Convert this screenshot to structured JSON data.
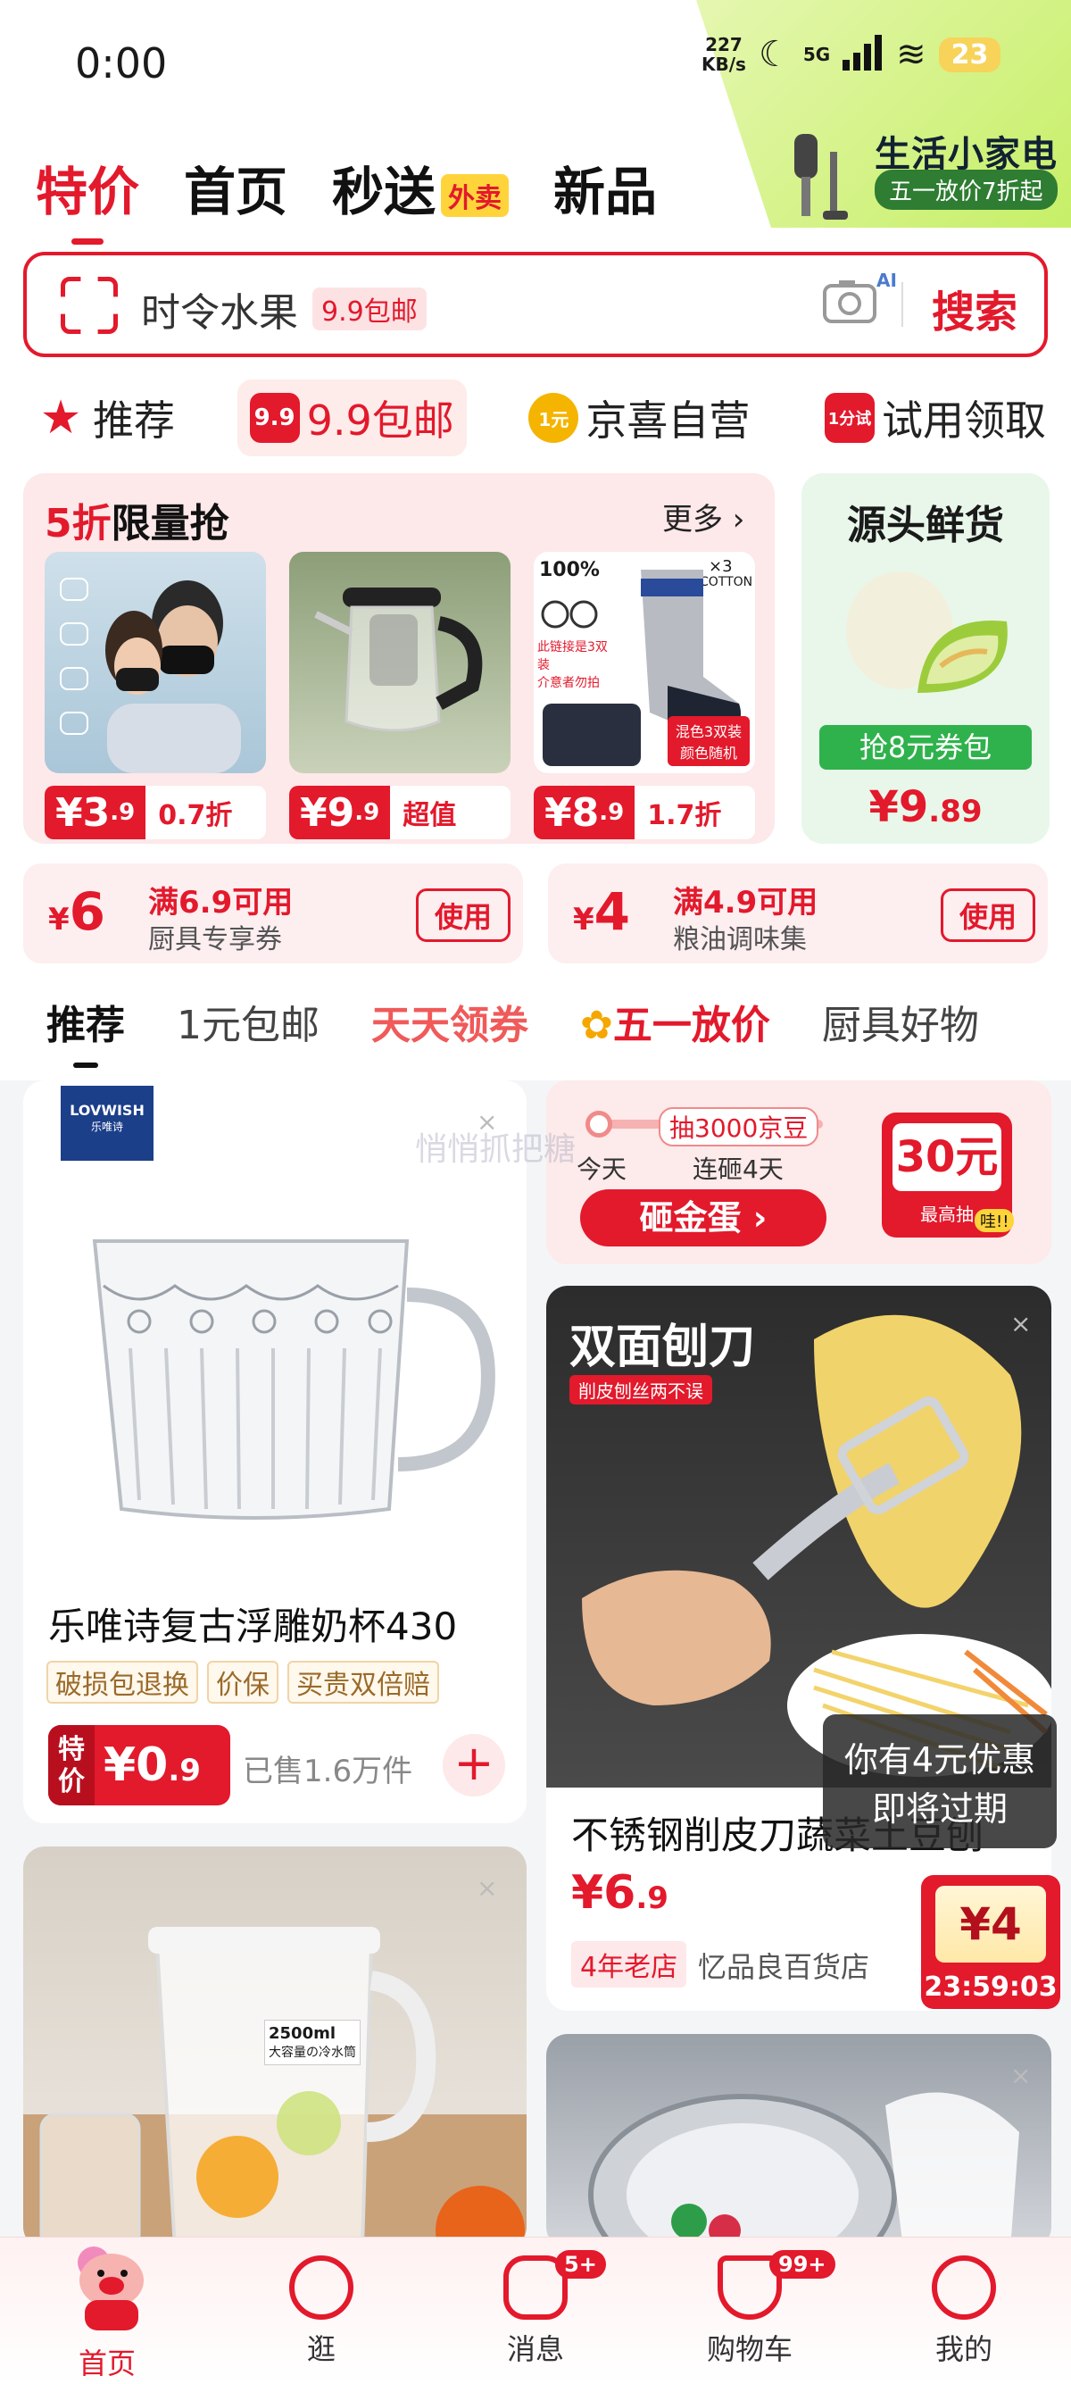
{
  "status": {
    "time": "0:00",
    "speed_top": "227",
    "speed_unit": "KB/s",
    "network": "5G",
    "battery": "23"
  },
  "promo": {
    "title": "生活小家电",
    "subtitle": "五一放价7折起"
  },
  "nav": {
    "tabs": [
      "特价",
      "首页",
      "秒送",
      "新品"
    ],
    "waimai": "外卖"
  },
  "search": {
    "text": "时令水果",
    "tag": "9.9包邮",
    "ai": "AI",
    "button": "搜索"
  },
  "cats": [
    {
      "label": "推荐",
      "icon": "★"
    },
    {
      "label": "9.9包邮",
      "icon": "9.9"
    },
    {
      "label": "京喜自营",
      "icon": "1元"
    },
    {
      "label": "试用领取",
      "icon": "1分试"
    }
  ],
  "flash": {
    "title_red": "5折",
    "title_rest": "限量抢",
    "more": "更多 ›",
    "items": [
      {
        "price": "¥3",
        "dec": ".9",
        "tag": "0.7折"
      },
      {
        "price": "¥9",
        "dec": ".9",
        "tag": "超值"
      },
      {
        "price": "¥8",
        "dec": ".9",
        "tag": "1.7折"
      }
    ],
    "socks_100": "100%",
    "socks_x3": "×3",
    "socks_cotton": "COTTON",
    "socks_note": "此链接是3双装\n介意者勿拍",
    "socks_badge": "混色3双装\n颜色随机"
  },
  "fresh": {
    "title": "源头鲜货",
    "btn": "抢8元券包",
    "price": "¥9",
    "dec": ".89"
  },
  "coupons": [
    {
      "amount": "6",
      "cond": "满6.9可用",
      "name": "厨具专享券",
      "btn": "使用"
    },
    {
      "amount": "4",
      "cond": "满4.9可用",
      "name": "粮油调味集",
      "btn": "使用"
    }
  ],
  "feed_tabs": [
    "推荐",
    "1元包邮",
    "天天领券",
    "五一放价",
    "厨具好物"
  ],
  "card1": {
    "brand": "LOVWISH",
    "brand_sub": "乐唯诗",
    "title": "乐唯诗复古浮雕奶杯430",
    "tags": [
      "破损包退换",
      "价保",
      "买贵双倍赔"
    ],
    "special": "特价",
    "price": "¥0",
    "dec": ".9",
    "sold": "已售1.6万件"
  },
  "egg": {
    "lottery": "抽3000京豆",
    "today": "今天",
    "streak": "连砸4天",
    "button": "砸金蛋 ›",
    "prize": "30元",
    "prize_label": "最高抽",
    "wow": "哇!!"
  },
  "card2": {
    "img_title": "双面刨刀",
    "img_sub": "削皮刨丝两不误",
    "title": "不锈钢削皮刀蔬菜土豆刨",
    "price": "¥6",
    "dec": ".9",
    "shop_tag": "4年老店",
    "shop": "忆品良百货店"
  },
  "jug": {
    "label1": "2500ml",
    "label2": "大容量の冷水筒"
  },
  "tooltip": "你有4元优惠\n即将过期",
  "timer": {
    "amount": "¥4",
    "time": "23:59:03"
  },
  "watermark": "悄悄抓把糖",
  "bottom": [
    {
      "label": "首页"
    },
    {
      "label": "逛"
    },
    {
      "label": "消息",
      "badge": "5+"
    },
    {
      "label": "购物车",
      "badge": "99+"
    },
    {
      "label": "我的"
    }
  ]
}
